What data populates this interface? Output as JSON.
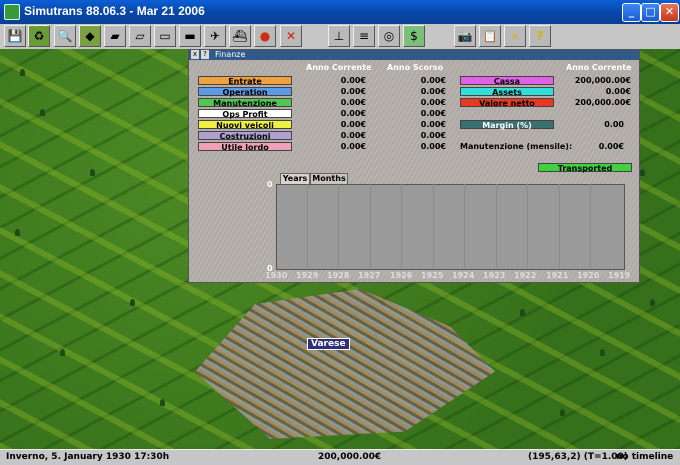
{
  "window": {
    "title": "Simutrans  88.06.3 - Mar 21 2006",
    "minimize": "_",
    "maximize": "□",
    "close": "✕"
  },
  "toolbar": {
    "icons": [
      "save-icon",
      "recycle-icon",
      "zoom-icon",
      "terrain-icon",
      "road-icon",
      "rail-icon",
      "tram-icon",
      "monorail-icon",
      "air-icon",
      "ship-icon",
      "stop-icon",
      "remove-icon",
      "junction-icon",
      "list-icon",
      "graph-icon",
      "money-icon",
      "screenshot-icon",
      "clipboard-icon",
      "fast-forward-icon",
      "help-icon"
    ]
  },
  "map": {
    "city_name": "Varese"
  },
  "finance": {
    "title": "Finanze",
    "close": "x",
    "help": "?",
    "headers": {
      "current_year": "Anno Corrente",
      "prev_year": "Anno Scorso",
      "current_year_right": "Anno Corrente"
    },
    "rows": [
      {
        "label": "Entrate",
        "color": "#f0a040",
        "current": "0.00€",
        "previous": "0.00€"
      },
      {
        "label": "Operation",
        "color": "#5a9ae8",
        "current": "0.00€",
        "previous": "0.00€"
      },
      {
        "label": "Manutenzione",
        "color": "#50c850",
        "current": "0.00€",
        "previous": "0.00€"
      },
      {
        "label": "Ops Profit",
        "color": "#ffffff",
        "current": "0.00€",
        "previous": "0.00€"
      },
      {
        "label": "Nuovi veicoli",
        "color": "#f0f040",
        "current": "0.00€",
        "previous": "0.00€"
      },
      {
        "label": "Costruzioni",
        "color": "#b0a0d0",
        "current": "0.00€",
        "previous": "0.00€"
      },
      {
        "label": "Utile lordo",
        "color": "#f0a0b8",
        "current": "0.00€",
        "previous": "0.00€"
      }
    ],
    "right_rows": [
      {
        "label": "Cassa",
        "color": "#e060e8",
        "value": "200,000.00€"
      },
      {
        "label": "Assets",
        "color": "#30e0d8",
        "value": "0.00€"
      },
      {
        "label": "Valore netto",
        "color": "#e83820",
        "value": "200,000.00€"
      },
      {
        "label": "Margin (%)",
        "color": "#3a7070",
        "value": "0.00"
      }
    ],
    "maintenance": {
      "label": "Manutenzione (mensile):",
      "value": "0.00€"
    },
    "transported": {
      "label": "Transported",
      "color": "#40d040"
    },
    "tabs": [
      "Years",
      "Months"
    ],
    "chart_y": {
      "top": "0",
      "bottom": "0"
    },
    "chart_x": [
      "1930",
      "1929",
      "1928",
      "1927",
      "1926",
      "1925",
      "1924",
      "1923",
      "1922",
      "1921",
      "1920",
      "1919"
    ]
  },
  "status": {
    "date": "Inverno, 5. January 1930 17:30h",
    "money": "200,000.00€",
    "coords": "(195,63,2) (T=1.00)",
    "timeline": "no timeline"
  }
}
